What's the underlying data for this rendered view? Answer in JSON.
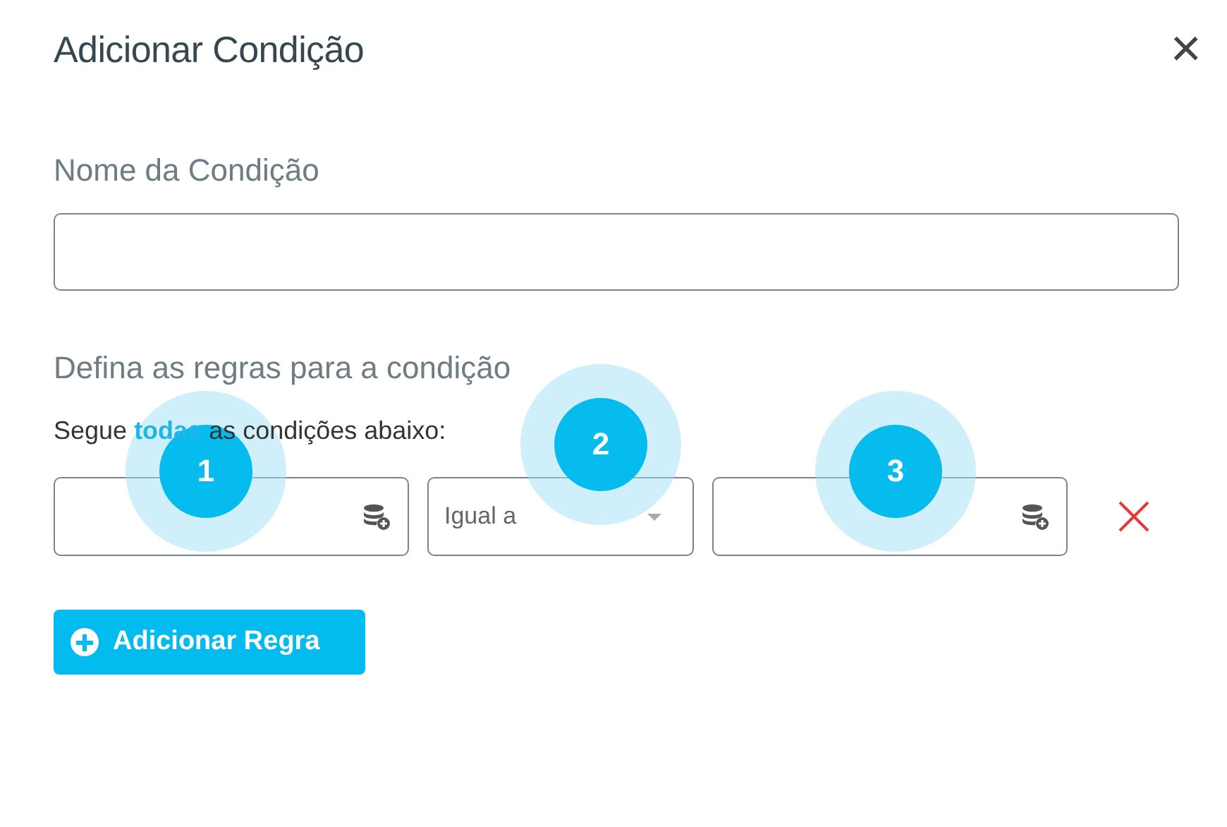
{
  "dialog": {
    "title": "Adicionar Condição",
    "close": "×"
  },
  "name_field": {
    "label": "Nome da Condição"
  },
  "rules_label": "Defina as regras para a condição",
  "rules_sentence": {
    "before": "Segue",
    "link": "todas",
    "after": "as condições abaixo:"
  },
  "rules": [
    {
      "operator": "Igual a"
    }
  ],
  "markers": [
    {
      "number": "1"
    },
    {
      "number": "2"
    },
    {
      "number": "3"
    }
  ],
  "add_button": {
    "label": "Adicionar Regra"
  }
}
